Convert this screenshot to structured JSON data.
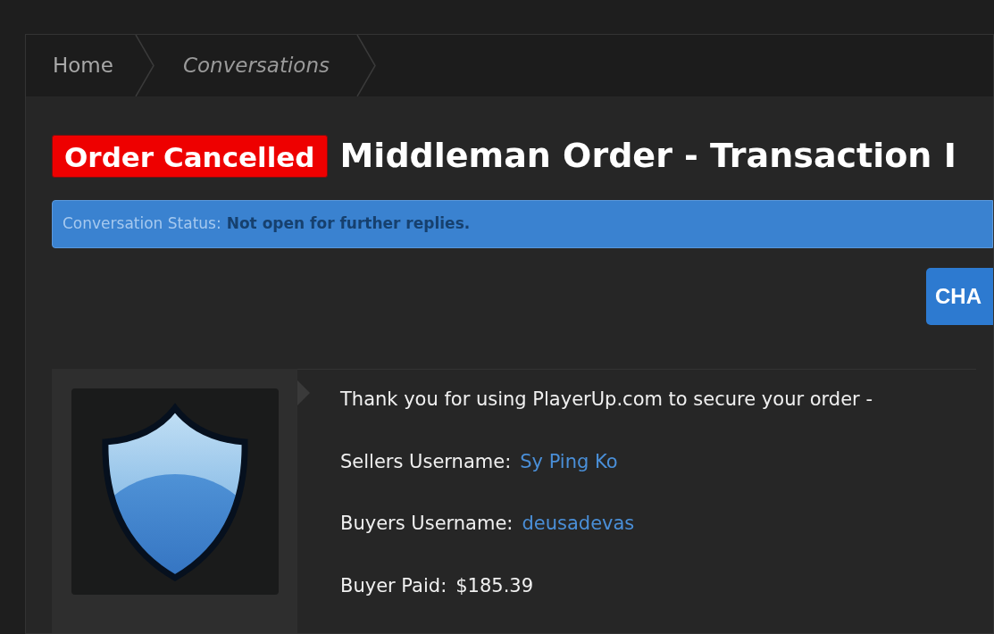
{
  "breadcrumb": [
    {
      "label": "Home",
      "current": false
    },
    {
      "label": "Conversations",
      "current": true
    }
  ],
  "header": {
    "badge": "Order Cancelled",
    "title": "Middleman Order - Transaction I"
  },
  "status": {
    "label": "Conversation Status:",
    "value": "Not open for further replies."
  },
  "action_button": "CHA",
  "message": {
    "intro": "Thank you for using PlayerUp.com to secure your order -",
    "fields": [
      {
        "label": "Sellers Username:",
        "value": "Sy Ping Ko",
        "kind": "link"
      },
      {
        "label": "Buyers Username:",
        "value": "deusadevas",
        "kind": "link"
      },
      {
        "label": "Buyer Paid:",
        "value": "$185.39",
        "kind": "text"
      }
    ]
  }
}
